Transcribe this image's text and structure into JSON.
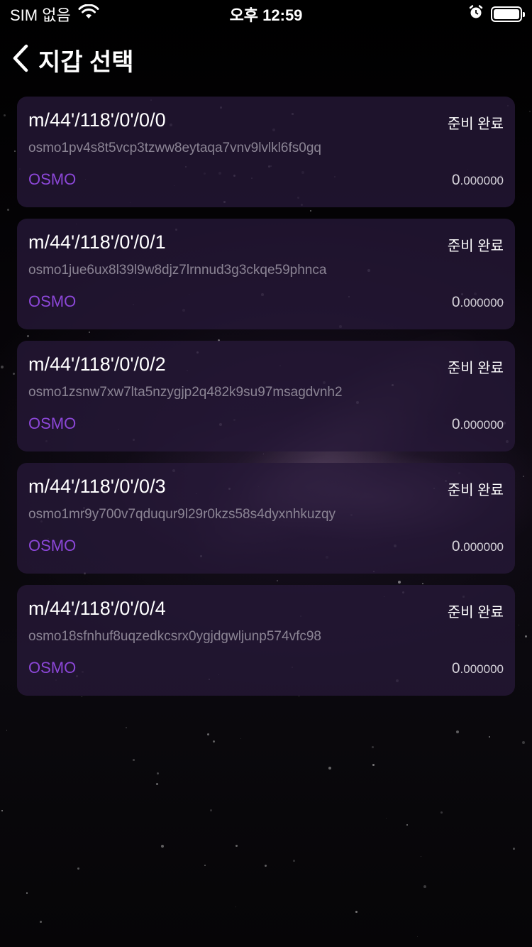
{
  "status_bar": {
    "carrier": "SIM 없음",
    "time": "오후 12:59"
  },
  "nav": {
    "title": "지갑 선택",
    "back_icon": "chevron-left-icon"
  },
  "wallets": [
    {
      "path": "m/44'/118'/0'/0/0",
      "status": "준비 완료",
      "address": "osmo1pv4s8t5vcp3tzww8eytaqa7vnv9lvlkl6fs0gq",
      "denom": "OSMO",
      "balance_int": "0",
      "balance_dec": ".000000"
    },
    {
      "path": "m/44'/118'/0'/0/1",
      "status": "준비 완료",
      "address": "osmo1jue6ux8l39l9w8djz7lrnnud3g3ckqe59phnca",
      "denom": "OSMO",
      "balance_int": "0",
      "balance_dec": ".000000"
    },
    {
      "path": "m/44'/118'/0'/0/2",
      "status": "준비 완료",
      "address": "osmo1zsnw7xw7lta5nzygjp2q482k9su97msagdvnh2",
      "denom": "OSMO",
      "balance_int": "0",
      "balance_dec": ".000000"
    },
    {
      "path": "m/44'/118'/0'/0/3",
      "status": "준비 완료",
      "address": "osmo1mr9y700v7qduqur9l29r0kzs58s4dyxnhkuzqy",
      "denom": "OSMO",
      "balance_int": "0",
      "balance_dec": ".000000"
    },
    {
      "path": "m/44'/118'/0'/0/4",
      "status": "준비 완료",
      "address": "osmo18sfnhuf8uqzedkcsrx0ygjdgwljunp574vfc98",
      "denom": "OSMO",
      "balance_int": "0",
      "balance_dec": ".000000"
    }
  ],
  "colors": {
    "accent": "#8c47d8",
    "card_bg": "#261838",
    "address": "#8b8494"
  }
}
